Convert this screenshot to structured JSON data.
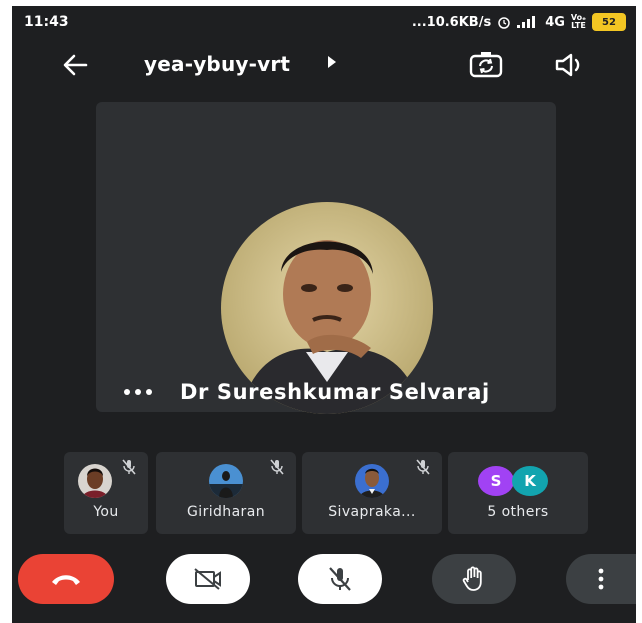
{
  "status_bar": {
    "time": "11:43",
    "speed": "...10.6KB/s",
    "network": "4G",
    "lte_top": "Voₑ",
    "lte_bottom": "LTE",
    "battery": "52"
  },
  "header": {
    "meeting_code": "yea-ybuy-vrt",
    "icons": [
      "back-arrow-icon",
      "caret-right-icon",
      "switch-camera-icon",
      "speaker-icon"
    ]
  },
  "main_tile": {
    "speaker_name": "Dr Sureshkumar Selvaraj",
    "more_icon": "more-horizontal-icon"
  },
  "participants": [
    {
      "name": "You",
      "muted": true
    },
    {
      "name": "Giridharan",
      "muted": true
    },
    {
      "name": "Sivapraka...",
      "muted": true
    },
    {
      "name": "5 others",
      "chips": [
        {
          "letter": "S",
          "color": "#a142f4"
        },
        {
          "letter": "K",
          "color": "#12a4af"
        }
      ]
    }
  ],
  "controls": {
    "end_call_color": "#ea4335",
    "icons": [
      "end-call-icon",
      "camera-off-icon",
      "mic-off-icon",
      "raise-hand-icon",
      "more-vertical-icon"
    ]
  },
  "colors": {
    "background": "#1e1f21",
    "tile": "#2e3033",
    "accent_end": "#ea4335"
  }
}
